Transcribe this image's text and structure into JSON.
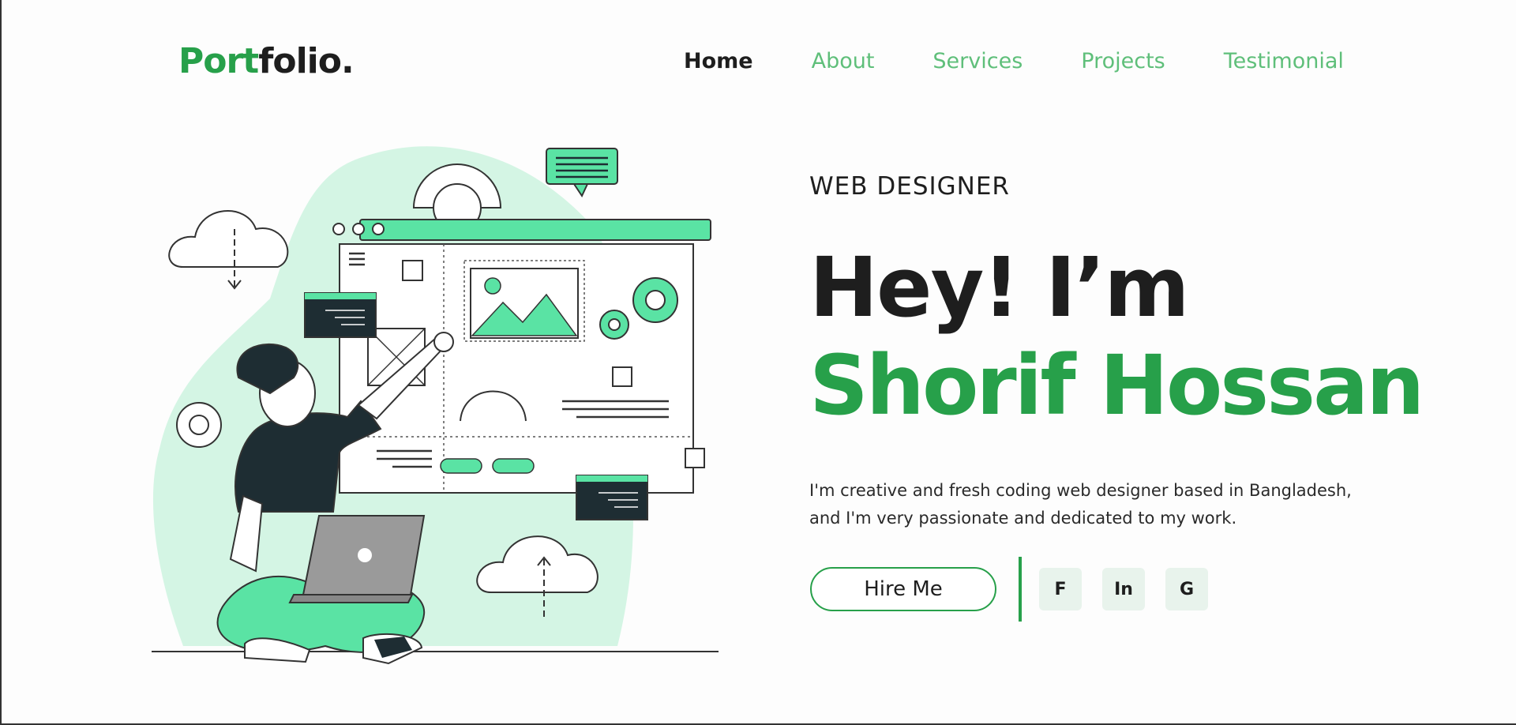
{
  "nav": {
    "logo_green": "Port",
    "logo_dark": "folio.",
    "links": [
      "Home",
      "About",
      "Services",
      "Projects",
      "Testimonial"
    ]
  },
  "hero": {
    "subtitle": "WEB DESIGNER",
    "greeting": "Hey! I’m",
    "name": "Shorif Hossan",
    "description": "I'm creative and fresh coding web designer based in Bangladesh, and I'm very passionate and dedicated to my work.",
    "hire_label": "Hire Me",
    "social": [
      "F",
      "In",
      "G"
    ]
  },
  "colors": {
    "accent": "#27a04a",
    "accent_light": "#5ae3a4",
    "blob": "#d4f5e4",
    "dark": "#1e2d33"
  }
}
